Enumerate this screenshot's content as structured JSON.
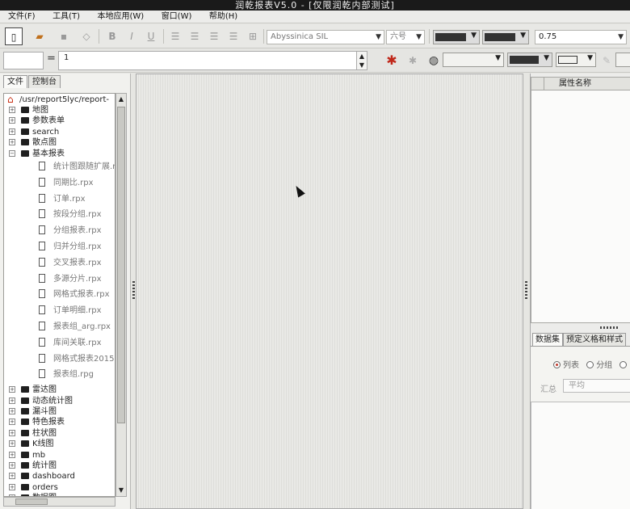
{
  "window": {
    "title": "润乾报表V5.0 - [仅限润乾内部测试]"
  },
  "menu": [
    "文件(F)",
    "工具(T)",
    "本地应用(W)",
    "窗口(W)",
    "帮助(H)"
  ],
  "toolbar": {
    "bold": "B",
    "italic": "I",
    "underline": "U",
    "font_family": "Abyssinica SIL",
    "font_size": "六号",
    "line_width": "0.75"
  },
  "formula_bar": {
    "cell_ref": "",
    "equals": "=",
    "value": "1"
  },
  "left_tabs": [
    "文件",
    "控制台"
  ],
  "tree": {
    "root": "/usr/report5lyc/report-",
    "folders_top": [
      "地图",
      "参数表单",
      "search",
      "散点图",
      "基本报表"
    ],
    "files": [
      "统计图跟随扩展.r",
      "同期比.rpx",
      "订单.rpx",
      "按段分组.rpx",
      "分组报表.rpx",
      "归并分组.rpx",
      "交叉报表.rpx",
      "多源分片.rpx",
      "网格式报表.rpx",
      "订单明细.rpx",
      "报表组_arg.rpx",
      "库间关联.rpx",
      "网格式报表2015",
      "报表组.rpg"
    ],
    "folders_bottom": [
      "雷达图",
      "动态统计图",
      "漏斗图",
      "特色报表",
      "柱状图",
      "K线图",
      "mb",
      "统计图",
      "dashboard",
      "orders",
      "数据图"
    ]
  },
  "properties": {
    "header": "属性名称"
  },
  "right_tabs": [
    "数据集",
    "预定义格和样式"
  ],
  "dataset": {
    "radio_options": [
      "列表",
      "分组",
      ""
    ],
    "selected": "列表",
    "sum_label": "汇总",
    "sum_value": "平均"
  }
}
